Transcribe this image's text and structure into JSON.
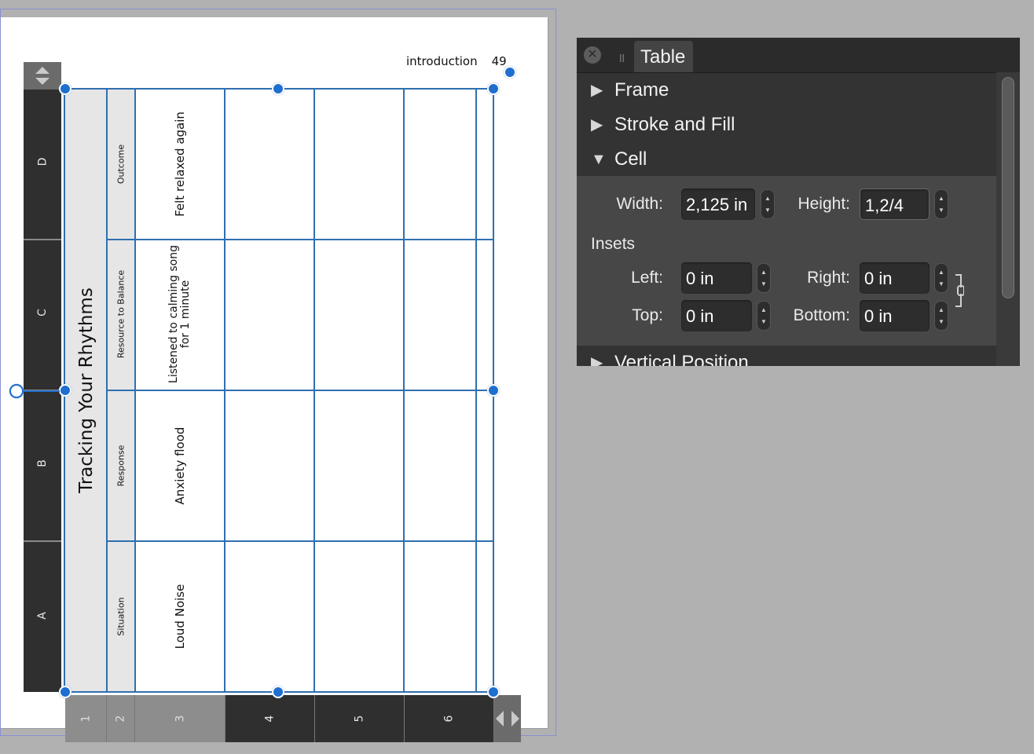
{
  "page": {
    "running_head": {
      "section": "introduction",
      "page_number": "49"
    }
  },
  "table": {
    "title": "Tracking Your Rhythms",
    "row_headers": [
      "A",
      "B",
      "C",
      "D"
    ],
    "column_headers": [
      "1",
      "2",
      "3",
      "4",
      "5",
      "6"
    ],
    "selected_column": "3",
    "rows": [
      {
        "category": "Situation",
        "entry": "Loud Noise"
      },
      {
        "category": "Response",
        "entry": "Anxiety flood"
      },
      {
        "category": "Resource to Balance",
        "entry_line1": "Listened to calming song",
        "entry_line2": "for 1 minute"
      },
      {
        "category": "Outcome",
        "entry": "Felt relaxed again"
      }
    ]
  },
  "panel": {
    "tab_title": "Table",
    "close_icon": "close-icon",
    "sections": {
      "frame": "Frame",
      "stroke_fill": "Stroke and Fill",
      "cell": "Cell",
      "vertical_position": "Vertical Position"
    },
    "cell": {
      "width_label": "Width:",
      "width_value": "2,125 in",
      "height_label": "Height:",
      "height_value": "1,2/4",
      "insets_label": "Insets",
      "left_label": "Left:",
      "left_value": "0 in",
      "right_label": "Right:",
      "right_value": "0 in",
      "top_label": "Top:",
      "top_value": "0 in",
      "bottom_label": "Bottom:",
      "bottom_value": "0 in"
    }
  },
  "colors": {
    "accent_blue": "#1e6fcf",
    "gridline": "#2f6fb0",
    "panel_bg": "#3a3a3a",
    "workspace_bg": "#b1b1b1"
  }
}
